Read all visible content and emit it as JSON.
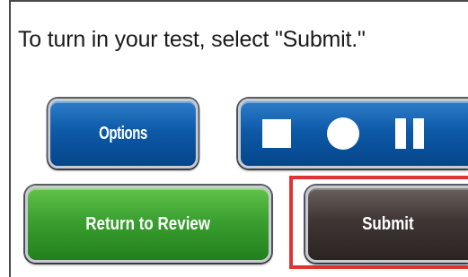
{
  "instruction_text": "To turn in your test, select \"Submit.\"",
  "buttons": {
    "options_label": "Options",
    "return_label": "Return to Review",
    "submit_label": "Submit"
  },
  "media_controls": {
    "icons": [
      "stop-icon",
      "record-icon",
      "pause-icon"
    ]
  },
  "colors": {
    "blue": "#0d5aa8",
    "green": "#3aa030",
    "dark": "#3f3634",
    "highlight": "#e03434"
  }
}
